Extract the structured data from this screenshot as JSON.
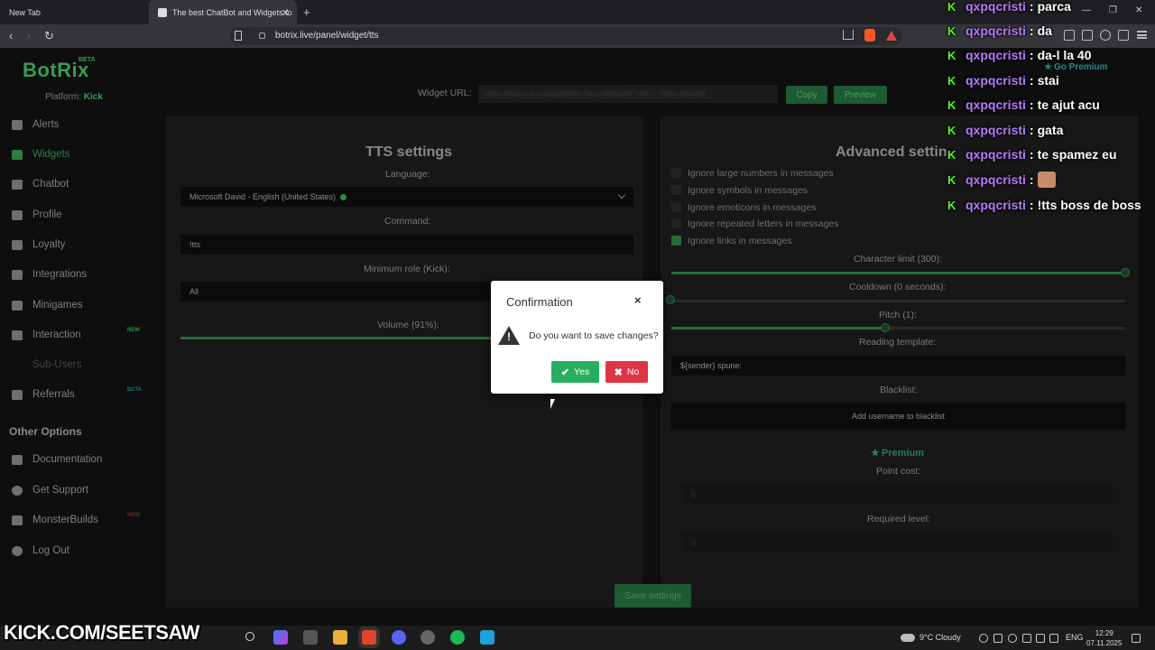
{
  "browser": {
    "tabs": [
      {
        "label": "New Tab"
      },
      {
        "label": "The best ChatBot and Widgets fo"
      }
    ],
    "new_tab_symbol": "+",
    "address": "botrix.live/panel/widget/tts",
    "window_controls": [
      "—",
      "❐",
      "✕"
    ]
  },
  "app": {
    "logo": "BotRix",
    "beta": "BETA",
    "platform_label": "Platform:",
    "platform_value": "Kick",
    "go_premium": "Go Premium",
    "sidebar": [
      {
        "label": "Alerts"
      },
      {
        "label": "Widgets"
      },
      {
        "label": "Chatbot"
      },
      {
        "label": "Profile"
      },
      {
        "label": "Loyalty"
      },
      {
        "label": "Integrations"
      },
      {
        "label": "Minigames"
      },
      {
        "label": "Interaction",
        "badge": "NEW"
      },
      {
        "label": "Sub-Users"
      },
      {
        "label": "Referrals",
        "badge": "BETA"
      }
    ],
    "other_options_title": "Other Options",
    "other_options": [
      {
        "label": "Documentation"
      },
      {
        "label": "Get Support"
      },
      {
        "label": "MonsterBuilds",
        "badge": "NEW"
      },
      {
        "label": "Log Out"
      }
    ],
    "widget_url_label": "Widget URL:",
    "widget_url_value": "https://botrix.live/widgets/tts?bid=8d9a2f67a9f1c7b33c4be4d5",
    "copy_label": "Copy",
    "preview_label": "Preview"
  },
  "tts": {
    "title": "TTS settings",
    "language_label": "Language:",
    "language_value": "Microsoft David - English (United States)",
    "command_label": "Command:",
    "command_value": "!tts",
    "min_role_label": "Minimum role (Kick):",
    "min_role_value": "All",
    "volume_label": "Volume (91%):",
    "volume": 91
  },
  "advanced": {
    "title": "Advanced settings",
    "options": [
      {
        "label": "Ignore large numbers in messages",
        "checked": false
      },
      {
        "label": "Ignore symbols in messages",
        "checked": false
      },
      {
        "label": "Ignore emoticons in messages",
        "checked": false
      },
      {
        "label": "Ignore repeated letters in messages",
        "checked": false
      },
      {
        "label": "Ignore links in messages",
        "checked": true
      }
    ],
    "char_limit_label": "Character limit (300):",
    "cooldown_label": "Cooldown (0 seconds):",
    "pitch_label": "Pitch (1):",
    "reading_template_label": "Reading template:",
    "reading_template_value": "${sender} spune:",
    "blacklist_label": "Blacklist:",
    "blacklist_placeholder": "Add username to blacklist",
    "premium_label": "Premium",
    "point_cost_label": "Point cost:",
    "point_cost_value": "0",
    "required_level_label": "Required level:",
    "required_level_value": "0"
  },
  "save_label": "Save settings",
  "modal": {
    "title": "Confirmation",
    "close": "×",
    "message": "Do you want to save changes?",
    "yes": "Yes",
    "no": "No"
  },
  "chat": [
    {
      "user": "qxpqcristi",
      "msg": "parca"
    },
    {
      "user": "qxpqcristi",
      "msg": "da"
    },
    {
      "user": "qxpqcristi",
      "msg": "da-l la 40"
    },
    {
      "user": "qxpqcristi",
      "msg": "stai"
    },
    {
      "user": "qxpqcristi",
      "msg": "te ajut acu"
    },
    {
      "user": "qxpqcristi",
      "msg": "gata"
    },
    {
      "user": "qxpqcristi",
      "msg": "te spamez eu"
    },
    {
      "user": "qxpqcristi",
      "msg": "",
      "emote": true
    },
    {
      "user": "qxpqcristi",
      "msg": "!tts boss de boss"
    }
  ],
  "overlay_brand": "KICK.COM/SEETSAW",
  "taskbar": {
    "weather": "9°C  Cloudy",
    "lang": "ENG",
    "time": "12:29",
    "date": "07.11.2025"
  }
}
